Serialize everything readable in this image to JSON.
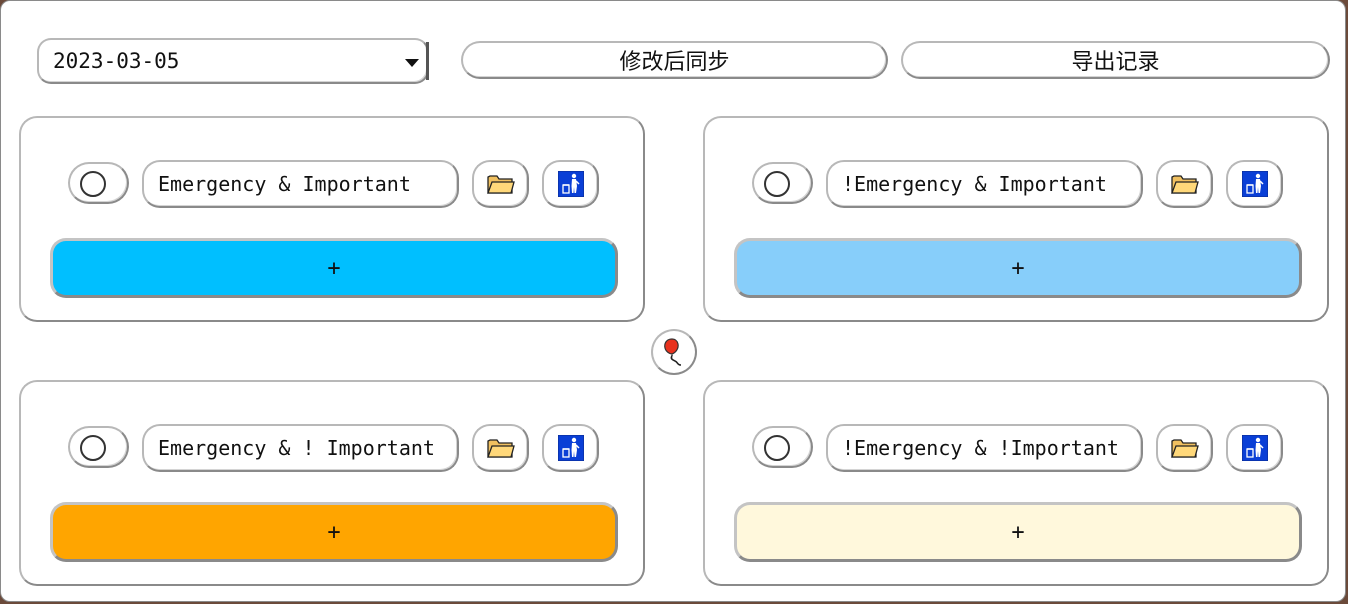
{
  "toolbar": {
    "date_value": "2023-03-05",
    "sync_label": "修改后同步",
    "export_label": "导出记录"
  },
  "quadrants": [
    {
      "title": "Emergency & Important",
      "add_label": "+",
      "color": "#00bfff"
    },
    {
      "title": "!Emergency & Important",
      "add_label": "+",
      "color": "#87cefa"
    },
    {
      "title": "Emergency & ! Important",
      "add_label": "+",
      "color": "#ffa500"
    },
    {
      "title": "!Emergency & !Important",
      "add_label": "+",
      "color": "#fff8dc"
    }
  ],
  "icons": {
    "toggle": "circle-icon",
    "folder": "folder-icon",
    "trash": "recycle-bin-icon",
    "center": "balloon-icon"
  }
}
